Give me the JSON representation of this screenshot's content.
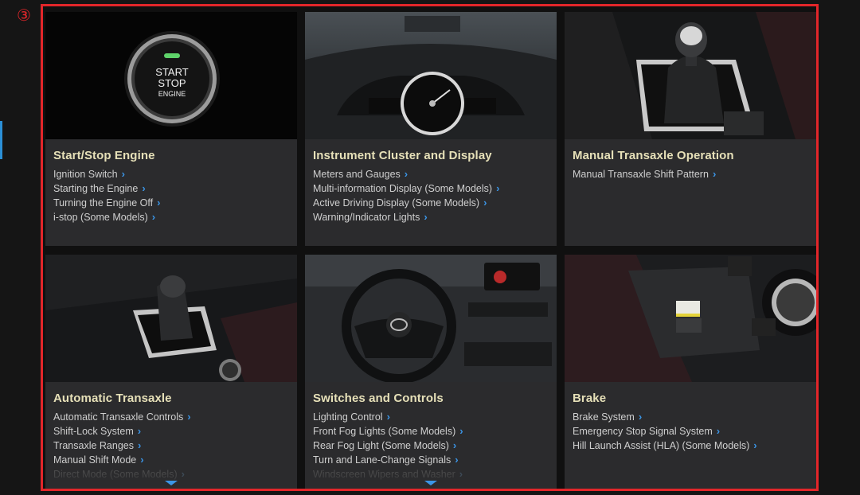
{
  "marker": "③",
  "cards": [
    {
      "title": "Start/Stop Engine",
      "button_text": [
        "START",
        "STOP",
        "ENGINE"
      ],
      "links": [
        "Ignition Switch",
        "Starting the Engine",
        "Turning the Engine Off",
        "i-stop (Some Models)"
      ]
    },
    {
      "title": "Instrument Cluster and Display",
      "links": [
        "Meters and Gauges",
        "Multi-information Display (Some Models)",
        "Active Driving Display (Some Models)",
        "Warning/Indicator Lights"
      ]
    },
    {
      "title": "Manual Transaxle Operation",
      "links": [
        "Manual Transaxle Shift Pattern"
      ]
    },
    {
      "title": "Automatic Transaxle",
      "links": [
        "Automatic Transaxle Controls",
        "Shift-Lock System",
        "Transaxle Ranges",
        "Manual Shift Mode",
        "Direct Mode (Some Models)"
      ]
    },
    {
      "title": "Switches and Controls",
      "links": [
        "Lighting Control",
        "Front Fog Lights (Some Models)",
        "Rear Fog Light (Some Models)",
        "Turn and Lane-Change Signals",
        "Windscreen Wipers and Washer"
      ]
    },
    {
      "title": "Brake",
      "links": [
        "Brake System",
        "Emergency Stop Signal System",
        "Hill Launch Assist (HLA) (Some Models)"
      ]
    }
  ],
  "icons": {
    "link_chevron": "chevron-right-icon",
    "more": "caret-down-icon"
  },
  "colors": {
    "frame": "#e3262a",
    "title": "#e6e0b8",
    "chevron": "#3b95e6",
    "card_bg": "#2b2b2d"
  }
}
